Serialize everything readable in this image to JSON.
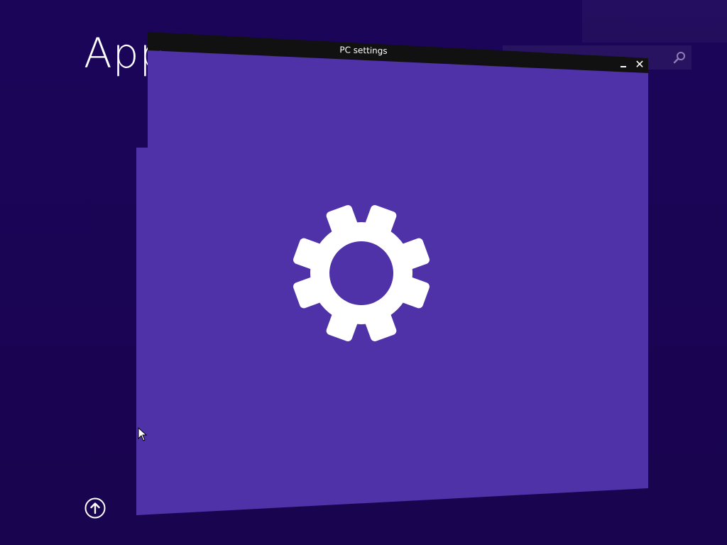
{
  "background": {
    "title": "App",
    "title_color": "#ffffff",
    "desktop_color": "#1b0559"
  },
  "search": {
    "icon": "search-icon"
  },
  "window": {
    "title": "PC settings",
    "titlebar_color": "#111111",
    "splash_color": "#4f31a8",
    "splash_icon": "gear-icon",
    "minimize_icon": "minimize-icon",
    "close_icon": "close-icon",
    "close_glyph": "✕"
  },
  "footer": {
    "up_icon": "arrow-up-circle-icon"
  }
}
